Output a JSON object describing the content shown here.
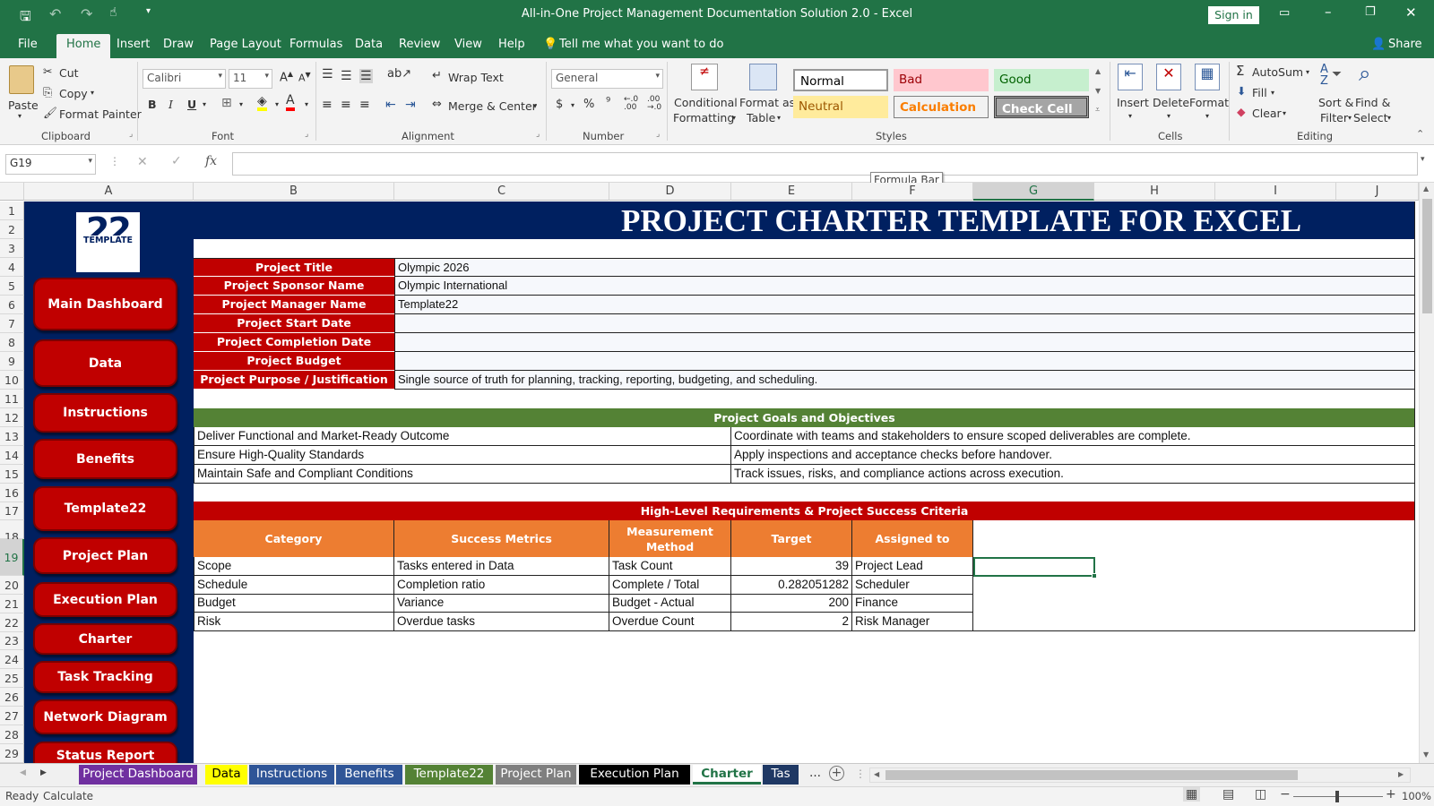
{
  "window": {
    "title": "All-in-One Project Management Documentation Solution 2.0  -  Excel",
    "sign_in": "Sign in"
  },
  "ribbon_tabs": [
    "File",
    "Home",
    "Insert",
    "Draw",
    "Page Layout",
    "Formulas",
    "Data",
    "Review",
    "View",
    "Help"
  ],
  "tell_me": "Tell me what you want to do",
  "share": "Share",
  "clipboard": {
    "paste": "Paste",
    "cut": "Cut",
    "copy": "Copy",
    "format_painter": "Format Painter",
    "label": "Clipboard"
  },
  "font": {
    "name": "Calibri",
    "size": "11",
    "label": "Font"
  },
  "alignment": {
    "wrap": "Wrap Text",
    "merge": "Merge & Center",
    "label": "Alignment"
  },
  "number": {
    "format": "General",
    "label": "Number"
  },
  "styles": {
    "conditional": "Conditional",
    "formatting": "Formatting",
    "format_as": "Format as",
    "table": "Table",
    "normal": "Normal",
    "bad": "Bad",
    "good": "Good",
    "neutral": "Neutral",
    "calculation": "Calculation",
    "check_cell": "Check Cell",
    "label": "Styles"
  },
  "cells": {
    "insert": "Insert",
    "delete": "Delete",
    "format": "Format",
    "label": "Cells"
  },
  "editing": {
    "autosum": "AutoSum",
    "fill": "Fill",
    "clear": "Clear",
    "sort": "Sort &",
    "filter": "Filter",
    "find": "Find &",
    "select": "Select",
    "label": "Editing"
  },
  "formula_bar": {
    "name_box": "G19",
    "tooltip": "Formula Bar",
    "fx": "fx"
  },
  "columns": [
    "A",
    "B",
    "C",
    "D",
    "E",
    "F",
    "G",
    "H",
    "I",
    "J"
  ],
  "rows": [
    "1",
    "2",
    "3",
    "4",
    "5",
    "6",
    "7",
    "8",
    "9",
    "10",
    "11",
    "12",
    "13",
    "14",
    "15",
    "16",
    "17",
    "18",
    "19",
    "20",
    "21",
    "22",
    "23",
    "24",
    "25",
    "26",
    "27",
    "28",
    "29"
  ],
  "logo": {
    "number": "22",
    "word": "TEMPLATE"
  },
  "nav_buttons": [
    "Main Dashboard",
    "Data",
    "Instructions",
    "Benefits",
    "Template22",
    "Project Plan",
    "Execution Plan",
    "Charter",
    "Task Tracking",
    "Network Diagram",
    "Status Report"
  ],
  "sheet_title": "PROJECT CHARTER TEMPLATE FOR EXCEL",
  "info": [
    {
      "label": "Project Title",
      "value": "Olympic 2026"
    },
    {
      "label": "Project Sponsor Name",
      "value": "Olympic International"
    },
    {
      "label": "Project Manager Name",
      "value": "Template22"
    },
    {
      "label": "Project Start Date",
      "value": ""
    },
    {
      "label": "Project Completion Date",
      "value": ""
    },
    {
      "label": "Project Budget",
      "value": ""
    },
    {
      "label": "Project Purpose / Justification",
      "value": "Single source of truth for planning, tracking, reporting, budgeting, and scheduling."
    }
  ],
  "goals": {
    "header": "Project Goals and Objectives",
    "items": [
      {
        "goal": "Deliver Functional and Market-Ready Outcome",
        "objective": "Coordinate with teams and stakeholders to ensure scoped deliverables are complete."
      },
      {
        "goal": "Ensure High-Quality Standards",
        "objective": "Apply inspections and acceptance checks before handover."
      },
      {
        "goal": "Maintain Safe and Compliant Conditions",
        "objective": "Track issues, risks, and compliance actions across execution."
      }
    ]
  },
  "requirements": {
    "header": "High-Level Requirements & Project Success Criteria",
    "columns": [
      "Category",
      "Success Metrics",
      "Measurement Method",
      "Target",
      "Assigned to"
    ],
    "rows": [
      {
        "category": "Scope",
        "metric": "Tasks entered in Data",
        "method": "Task Count",
        "target": "39",
        "assigned": "Project Lead"
      },
      {
        "category": "Schedule",
        "metric": "Completion ratio",
        "method": "Complete / Total",
        "target": "0.282051282",
        "assigned": "Scheduler"
      },
      {
        "category": "Budget",
        "metric": "Variance",
        "method": "Budget - Actual",
        "target": "200",
        "assigned": "Finance"
      },
      {
        "category": "Risk",
        "metric": "Overdue tasks",
        "method": "Overdue Count",
        "target": "2",
        "assigned": "Risk Manager"
      }
    ]
  },
  "sheet_tabs": [
    {
      "name": "Project Dashboard",
      "bg": "#7030a0",
      "fg": "#ffffff"
    },
    {
      "name": "Data",
      "bg": "#ffff00",
      "fg": "#000000"
    },
    {
      "name": "Instructions",
      "bg": "#2f5597",
      "fg": "#ffffff"
    },
    {
      "name": "Benefits",
      "bg": "#2f5597",
      "fg": "#ffffff"
    },
    {
      "name": "Template22",
      "bg": "#548235",
      "fg": "#ffffff"
    },
    {
      "name": "Project Plan",
      "bg": "#7f7f7f",
      "fg": "#ffffff"
    },
    {
      "name": "Execution Plan",
      "bg": "#000000",
      "fg": "#ffffff"
    },
    {
      "name": "Charter",
      "bg": "#ffffff",
      "fg": "#217346"
    },
    {
      "name": "Tas",
      "bg": "#1f3864",
      "fg": "#ffffff"
    }
  ],
  "status": {
    "ready": "Ready",
    "calculate": "Calculate",
    "zoom": "100%"
  },
  "colors": {
    "excel_green": "#217346",
    "navy": "#002060",
    "red": "#c00000",
    "orange": "#ed7d31",
    "goal_green": "#548235"
  }
}
